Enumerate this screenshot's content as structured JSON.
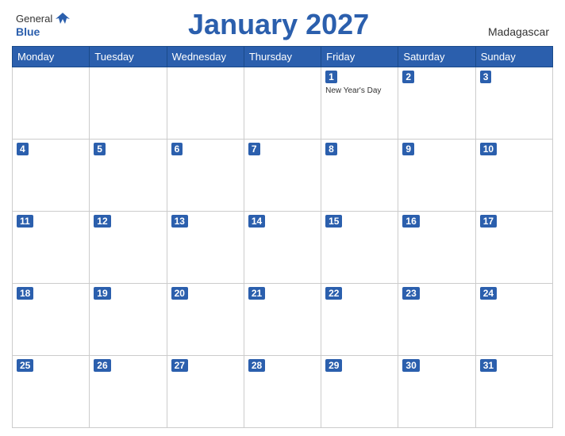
{
  "header": {
    "logo_general": "General",
    "logo_blue": "Blue",
    "title": "January 2027",
    "country": "Madagascar"
  },
  "days_of_week": [
    "Monday",
    "Tuesday",
    "Wednesday",
    "Thursday",
    "Friday",
    "Saturday",
    "Sunday"
  ],
  "weeks": [
    [
      {
        "day": null
      },
      {
        "day": null
      },
      {
        "day": null
      },
      {
        "day": null
      },
      {
        "day": "1",
        "holiday": "New Year's Day"
      },
      {
        "day": "2"
      },
      {
        "day": "3"
      }
    ],
    [
      {
        "day": "4"
      },
      {
        "day": "5"
      },
      {
        "day": "6"
      },
      {
        "day": "7"
      },
      {
        "day": "8"
      },
      {
        "day": "9"
      },
      {
        "day": "10"
      }
    ],
    [
      {
        "day": "11"
      },
      {
        "day": "12"
      },
      {
        "day": "13"
      },
      {
        "day": "14"
      },
      {
        "day": "15"
      },
      {
        "day": "16"
      },
      {
        "day": "17"
      }
    ],
    [
      {
        "day": "18"
      },
      {
        "day": "19"
      },
      {
        "day": "20"
      },
      {
        "day": "21"
      },
      {
        "day": "22"
      },
      {
        "day": "23"
      },
      {
        "day": "24"
      }
    ],
    [
      {
        "day": "25"
      },
      {
        "day": "26"
      },
      {
        "day": "27"
      },
      {
        "day": "28"
      },
      {
        "day": "29"
      },
      {
        "day": "30"
      },
      {
        "day": "31"
      }
    ]
  ]
}
